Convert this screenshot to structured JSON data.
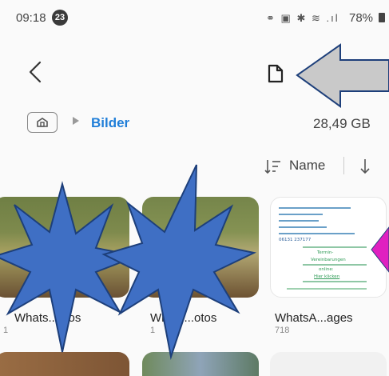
{
  "status_bar": {
    "time": "09:18",
    "notification_count": "23",
    "battery": "78%",
    "icons": [
      "link-icon",
      "lock-icon",
      "bluetooth-icon",
      "wifi-icon",
      "signal-icon",
      "battery-icon"
    ]
  },
  "breadcrumb": {
    "home_icon": "home-icon",
    "folder": "Bilder"
  },
  "storage": {
    "size": "28,49 GB"
  },
  "sort": {
    "label": "Name"
  },
  "albums": [
    {
      "name": "Whats...otos",
      "count": "1"
    },
    {
      "name": "Whats...otos",
      "count": "1"
    },
    {
      "name": "WhatsA...ages",
      "count": "718"
    }
  ],
  "document_preview": {
    "line1": "Termin-",
    "line2": "Vereinbarungen",
    "line3": "online:",
    "line4": "Hier klicken",
    "phone": "06131 237177"
  },
  "annotation_colors": {
    "arrow": "#c9c9c9",
    "starburst": "#3f6fc4",
    "pointer": "#e020c0"
  }
}
